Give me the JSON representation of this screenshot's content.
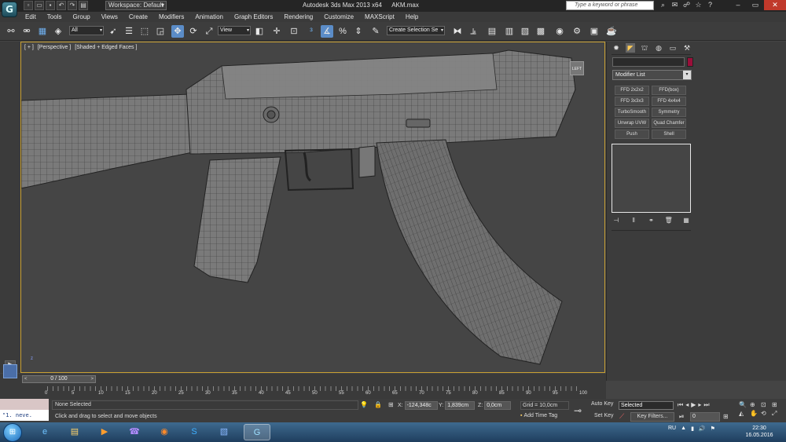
{
  "title_bar": {
    "app_logo": "3ds Max logo",
    "workspace_label": "Workspace: Default",
    "app_title": "Autodesk 3ds Max  2013 x64",
    "file_name": "AKM.max",
    "help_search_placeholder": "Type a keyword or phrase"
  },
  "menu": {
    "items": [
      "Edit",
      "Tools",
      "Group",
      "Views",
      "Create",
      "Modifiers",
      "Animation",
      "Graph Editors",
      "Rendering",
      "Customize",
      "MAXScript",
      "Help"
    ]
  },
  "toolbar": {
    "selection_filter": "All",
    "ref_coord": "View",
    "named_selection": "Create Selection Se"
  },
  "viewport": {
    "label_parts": [
      "[ + ]",
      "[Perspective ]",
      "[Shaded + Edged Faces ]"
    ],
    "viewcube_label": "LEFT",
    "axis_label": "z"
  },
  "command_panel": {
    "object_color": "#9a0f3a",
    "modifier_list_label": "Modifier List",
    "modifier_buttons": [
      "FFD 2x2x2",
      "FFD(box)",
      "FFD 3x3x3",
      "FFD 4x4x4",
      "TurboSmooth",
      "Symmetry",
      "Unwrap UVW",
      "Quad Chamfer",
      "Push",
      "Shell"
    ]
  },
  "timeline": {
    "slider_text": "0 / 100",
    "ticks": [
      "0",
      "5",
      "10",
      "15",
      "20",
      "25",
      "30",
      "35",
      "40",
      "45",
      "50",
      "55",
      "60",
      "65",
      "70",
      "75",
      "80",
      "85",
      "90",
      "95",
      "100"
    ]
  },
  "status_bar": {
    "listener_text": "\"1.  neve.",
    "selection_status": "None Selected",
    "prompt": "Click and drag to select and move objects",
    "x_label": "X:",
    "x_value": "-124,348c",
    "y_label": "Y:",
    "y_value": "1,839cm",
    "z_label": "Z:",
    "z_value": "0,0cm",
    "grid": "Grid = 10,0cm",
    "add_time_tag": "Add Time Tag",
    "auto_key": "Auto Key",
    "set_key": "Set Key",
    "selected_dropdown": "Selected",
    "key_filters": "Key Filters...",
    "frame_value": "0"
  },
  "taskbar": {
    "language": "RU",
    "time": "22:30",
    "date": "16.05.2016"
  }
}
